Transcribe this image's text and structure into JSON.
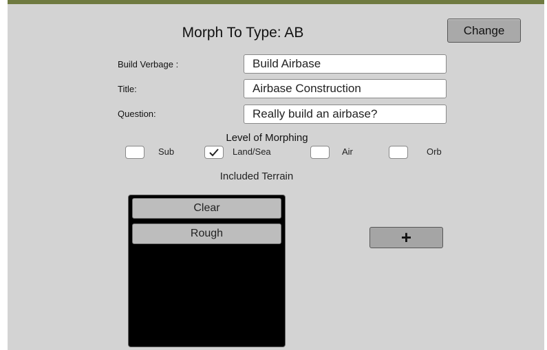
{
  "header": {
    "title": "Morph To Type: AB",
    "change_label": "Change"
  },
  "form": {
    "build_verbage_label": "Build Verbage :",
    "build_verbage_value": "Build Airbase",
    "title_label": "Title:",
    "title_value": "Airbase Construction",
    "question_label": "Question:",
    "question_value": "Really build an airbase?"
  },
  "morphing": {
    "title": "Level of Morphing",
    "options": [
      {
        "label": "Sub",
        "checked": false
      },
      {
        "label": "Land/Sea",
        "checked": true
      },
      {
        "label": "Air",
        "checked": false
      },
      {
        "label": "Orb",
        "checked": false
      }
    ]
  },
  "terrain": {
    "title": "Included Terrain",
    "items": [
      "Clear",
      "Rough"
    ],
    "add_label": "+"
  },
  "colors": {
    "panel_bg": "#d3d3d3",
    "top_accent": "#6f7a40",
    "button_bg": "#a9a9a9",
    "list_bg": "#000000"
  },
  "icons": {
    "checkmark": "check-icon"
  }
}
